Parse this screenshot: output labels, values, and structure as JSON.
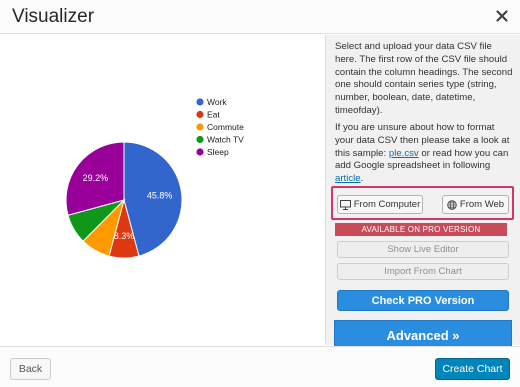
{
  "window": {
    "title": "Visualizer",
    "close_icon": "close-icon"
  },
  "sidebar": {
    "intro_text": "Select and upload your data CSV file here. The first row of the CSV file should contain the column headings. The second one should contain series type (string, number, boolean, date, datetime, timeofday).",
    "help_text_before": "If you are unsure about how to format your data CSV then please take a look at this sample: ",
    "sample_link": "ple.csv",
    "help_text_middle": " or read how you can add Google spreadsheet in following ",
    "article_link": "article",
    "help_text_after": ".",
    "from_computer_label": "From Computer",
    "from_web_label": "From Web",
    "pro_ribbon": "AVAILABLE ON PRO VERSION",
    "live_editor_label": "Show Live Editor",
    "import_chart_label": "Import From Chart",
    "check_pro_label": "Check PRO Version",
    "advanced_label": "Advanced »"
  },
  "footer": {
    "back_label": "Back",
    "create_label": "Create Chart"
  },
  "colors": {
    "accent": "#2b8de0",
    "create": "#0085ba",
    "highlight": "#d8326c",
    "pro_ribbon": "#c94a58"
  },
  "chart_data": {
    "type": "pie",
    "categories": [
      "Work",
      "Eat",
      "Commute",
      "Watch TV",
      "Sleep"
    ],
    "values": [
      45.8,
      8.3,
      8.3,
      8.3,
      29.2
    ],
    "labels": [
      "45.8%",
      "8.3%",
      "",
      "",
      "29.2%"
    ],
    "colors": [
      "#3366cc",
      "#dc3912",
      "#ff9900",
      "#109618",
      "#990099"
    ],
    "legend": "right"
  }
}
